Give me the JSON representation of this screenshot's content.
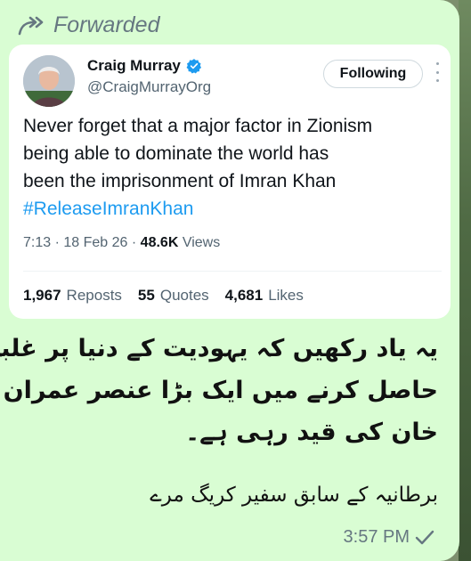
{
  "message": {
    "forwarded_label": "Forwarded",
    "time": "3:57 PM",
    "urdu_lines": [
      "یہ یاد رکھیں کہ یہودیت کے دنیا پر غلبہ",
      "حاصل کرنے میں ایک بڑا عنصر عمران",
      "خان کی قید رہی ہے۔"
    ],
    "urdu_attribution": "برطانیہ کے سابق سفیر کریگ مرے"
  },
  "tweet": {
    "author_name": "Craig Murray",
    "handle": "@CraigMurrayOrg",
    "follow_label": "Following",
    "text_lines": [
      "Never forget that a major factor in Zionism",
      "being able to dominate the world has",
      "been the imprisonment of Imran Khan"
    ],
    "hashtag": "#ReleaseImranKhan",
    "time": "7:13",
    "date": "18 Feb 26",
    "views_count": "48.6K",
    "views_label": "Views",
    "reposts_count": "1,967",
    "reposts_label": "Reposts",
    "quotes_count": "55",
    "quotes_label": "Quotes",
    "likes_count": "4,681",
    "likes_label": "Likes"
  },
  "colors": {
    "bubble": "#d9fdd3",
    "hashtag": "#1d9bf0",
    "verified": "#1d9bf0",
    "meta_text": "#536471"
  },
  "icons": {
    "forwarded": "forward-arrow-icon",
    "verified": "verified-badge-icon",
    "more": "more-vertical-icon",
    "read_receipt": "single-check-icon"
  }
}
